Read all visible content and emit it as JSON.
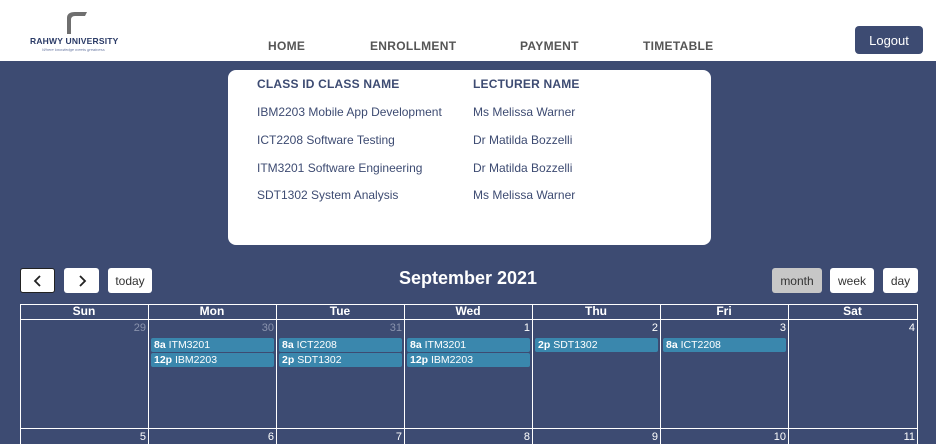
{
  "brand": {
    "name": "RAHWY UNIVERSITY",
    "tagline": "Where knowledge meets greatness"
  },
  "nav": [
    "HOME",
    "ENROLLMENT",
    "PAYMENT",
    "TIMETABLE"
  ],
  "logout_label": "Logout",
  "classes": {
    "headers": [
      "CLASS ID CLASS NAME",
      "LECTURER NAME"
    ],
    "rows": [
      {
        "class": "IBM2203 Mobile App Development",
        "lecturer": "Ms Melissa Warner"
      },
      {
        "class": "ICT2208 Software Testing",
        "lecturer": "Dr Matilda Bozzelli"
      },
      {
        "class": "ITM3201 Software Engineering",
        "lecturer": "Dr Matilda Bozzelli"
      },
      {
        "class": "SDT1302 System Analysis",
        "lecturer": "Ms Melissa Warner"
      }
    ]
  },
  "calendar": {
    "title": "September 2021",
    "prev_icon": "chevron-left-icon",
    "next_icon": "chevron-right-icon",
    "today_label": "today",
    "views": [
      "month",
      "week",
      "day"
    ],
    "active_view": "month",
    "weekdays": [
      "Sun",
      "Mon",
      "Tue",
      "Wed",
      "Thu",
      "Fri",
      "Sat"
    ],
    "week1_days": [
      "29",
      "30",
      "31",
      "1",
      "2",
      "3",
      "4"
    ],
    "week2_days": [
      "5",
      "6",
      "7",
      "8",
      "9",
      "10",
      "11"
    ],
    "events": [
      {
        "day": "Mon",
        "time": "8a",
        "title": "ITM3201"
      },
      {
        "day": "Mon",
        "time": "12p",
        "title": "IBM2203"
      },
      {
        "day": "Tue",
        "time": "8a",
        "title": "ICT2208"
      },
      {
        "day": "Tue",
        "time": "2p",
        "title": "SDT1302"
      },
      {
        "day": "Wed",
        "time": "8a",
        "title": "ITM3201"
      },
      {
        "day": "Wed",
        "time": "12p",
        "title": "IBM2203"
      },
      {
        "day": "Thu",
        "time": "2p",
        "title": "SDT1302"
      },
      {
        "day": "Fri",
        "time": "8a",
        "title": "ICT2208"
      }
    ],
    "event_color": "#3a87ad"
  }
}
